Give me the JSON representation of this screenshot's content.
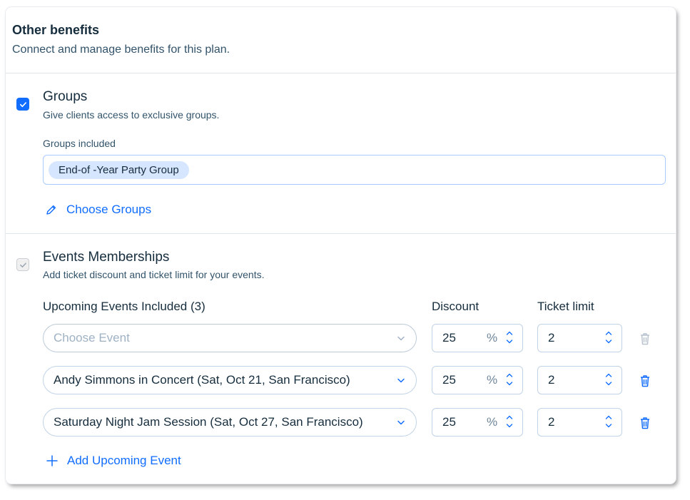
{
  "card": {
    "title": "Other benefits",
    "subtitle": "Connect and manage benefits for this plan."
  },
  "groups": {
    "checked": true,
    "title": "Groups",
    "description": "Give clients access to exclusive groups.",
    "field_label": "Groups included",
    "tags": [
      "End-of -Year Party Group"
    ],
    "choose_link": "Choose Groups"
  },
  "events": {
    "checked": true,
    "enabled": false,
    "title": "Events Memberships",
    "description": "Add ticket discount and ticket limit for your events.",
    "columns": {
      "events": "Upcoming Events Included (3)",
      "discount": "Discount",
      "ticket_limit": "Ticket limit"
    },
    "rows": [
      {
        "event": "",
        "placeholder": "Choose Event",
        "discount": "25",
        "discount_unit": "%",
        "ticket_limit": "2",
        "delete_enabled": false
      },
      {
        "event": "Andy Simmons in Concert (Sat, Oct 21, San Francisco)",
        "placeholder": "",
        "discount": "25",
        "discount_unit": "%",
        "ticket_limit": "2",
        "delete_enabled": true
      },
      {
        "event": "Saturday Night Jam Session (Sat, Oct 27, San Francisco)",
        "placeholder": "",
        "discount": "25",
        "discount_unit": "%",
        "ticket_limit": "2",
        "delete_enabled": true
      }
    ],
    "add_link": "Add Upcoming Event"
  },
  "colors": {
    "accent": "#116dff",
    "text": "#162d3d",
    "secondary_text": "#32536a",
    "tag_background": "#d6e6fe",
    "disabled_icon": "#b6c1cd"
  },
  "icons": [
    "check-icon",
    "pencil-icon",
    "chevron-down-icon",
    "stepper-icon",
    "trash-icon",
    "plus-icon"
  ]
}
